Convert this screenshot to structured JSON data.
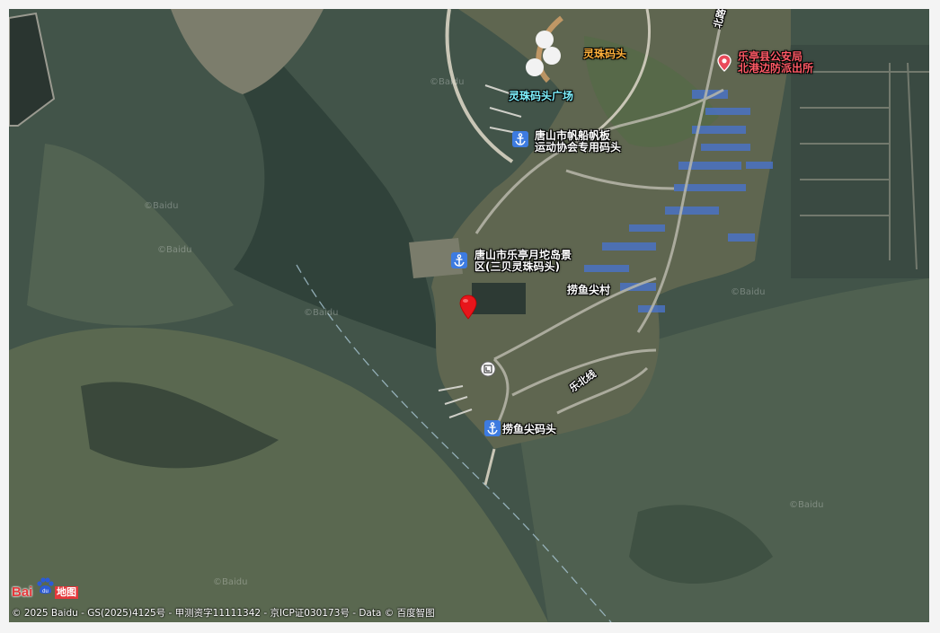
{
  "map": {
    "places": {
      "lingzhu_pier": "灵珠码头",
      "lingzhu_square": "灵珠码头广场",
      "sailing_pier_line1": "唐山市帆船帆板",
      "sailing_pier_line2": "运动协会专用码头",
      "police_line1": "乐亭县公安局",
      "police_line2": "北港边防派出所",
      "scenic_line1": "唐山市乐亭月坨岛景",
      "scenic_line2": "区(三贝灵珠码头)",
      "village": "捞鱼尖村",
      "laoyujian_pier": "捞鱼尖码头",
      "road_lebei": "乐北线",
      "road_north": "北路"
    },
    "watermark_text": "©Baidu",
    "icons": {
      "pier": "anchor-icon",
      "police": "map-pin-icon",
      "selected": "red-location-marker-icon",
      "info": "info-sign-icon"
    },
    "colors": {
      "anchor_badge": "#3d7be0",
      "selected_marker": "#e8151b",
      "poi_pin": "#ea4a5a"
    }
  },
  "footer": {
    "copyright": "© 2025 Baidu - GS(2025)4125号 - 甲测资字11111342 - 京ICP证030173号 - Data © 百度智图",
    "logo_bai": "Bai",
    "logo_du": "du",
    "logo_cn": "地图"
  }
}
